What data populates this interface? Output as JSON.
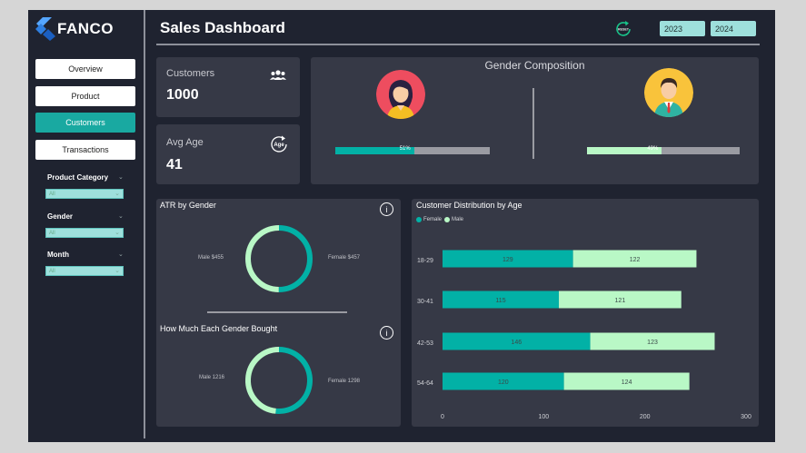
{
  "brand": {
    "name": "FANCO"
  },
  "header": {
    "title": "Sales Dashboard",
    "reset_label": "RESET",
    "years": [
      "2023",
      "2024"
    ]
  },
  "nav": [
    {
      "label": "Overview",
      "active": false
    },
    {
      "label": "Product",
      "active": false
    },
    {
      "label": "Customers",
      "active": true
    },
    {
      "label": "Transactions",
      "active": false
    }
  ],
  "filters": [
    {
      "label": "Product Category",
      "value": "All"
    },
    {
      "label": "Gender",
      "value": "All"
    },
    {
      "label": "Month",
      "value": "All"
    }
  ],
  "kpis": {
    "customers": {
      "label": "Customers",
      "value": "1000",
      "icon": "people-icon"
    },
    "avg_age": {
      "label": "Avg Age",
      "value": "41",
      "icon": "age-icon",
      "icon_text": "Age"
    }
  },
  "gender_composition": {
    "title": "Gender Composition",
    "female": {
      "percent": 51,
      "label": "51%"
    },
    "male": {
      "percent": 49,
      "label": "49%"
    }
  },
  "colors": {
    "female": "#02b1a6",
    "male": "#b9f8c6"
  },
  "chart_data": [
    {
      "type": "pie",
      "title": "ATR by Gender",
      "categories": [
        "Male",
        "Female"
      ],
      "values": [
        455,
        457
      ],
      "labels": [
        "Male $455",
        "Female $457"
      ]
    },
    {
      "type": "pie",
      "title": "How Much Each Gender Bought",
      "categories": [
        "Male",
        "Female"
      ],
      "values": [
        1216,
        1298
      ],
      "labels": [
        "Male 1216",
        "Female 1298"
      ]
    },
    {
      "type": "bar",
      "orientation": "horizontal",
      "stacked": true,
      "title": "Customer Distribution by Age",
      "categories": [
        "18-29",
        "30-41",
        "42-53",
        "54-64"
      ],
      "series": [
        {
          "name": "Female",
          "values": [
            129,
            115,
            146,
            120
          ]
        },
        {
          "name": "Male",
          "values": [
            122,
            121,
            123,
            124
          ]
        }
      ],
      "xlim": [
        0,
        300
      ],
      "xticks": [
        "0",
        "100",
        "200",
        "300"
      ],
      "legend": "top-left"
    }
  ]
}
